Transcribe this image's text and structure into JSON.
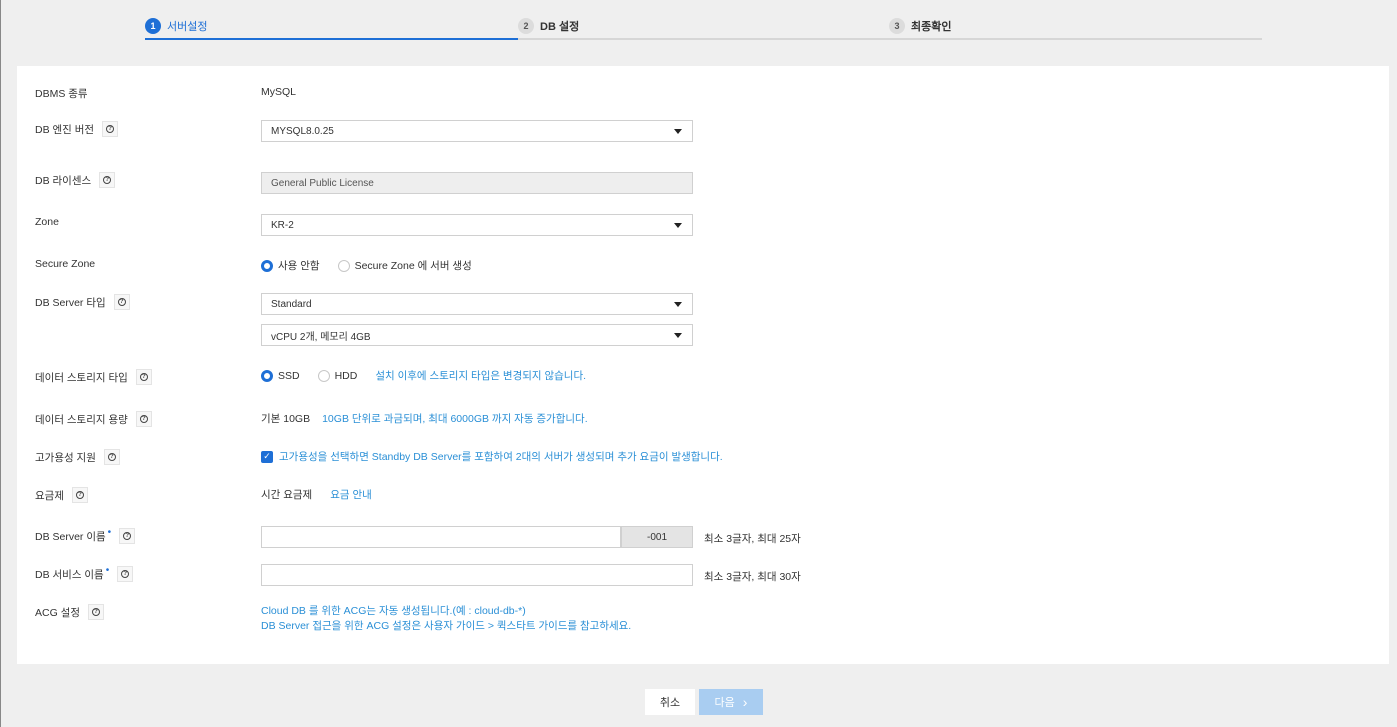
{
  "stepper": {
    "steps": [
      {
        "num": "1",
        "label": "서버설정"
      },
      {
        "num": "2",
        "label": "DB 설정"
      },
      {
        "num": "3",
        "label": "최종확인"
      }
    ]
  },
  "form": {
    "dbms_type": {
      "label": "DBMS 종류",
      "value": "MySQL"
    },
    "engine_version": {
      "label": "DB 엔진 버전",
      "value": "MYSQL8.0.25"
    },
    "license": {
      "label": "DB 라이센스",
      "value": "General Public License"
    },
    "zone": {
      "label": "Zone",
      "value": "KR-2"
    },
    "secure_zone": {
      "label": "Secure Zone",
      "option_off": "사용 안함",
      "option_on": "Secure Zone 에 서버 생성"
    },
    "server_type": {
      "label": "DB Server 타입",
      "type_value": "Standard",
      "spec_value": "vCPU 2개, 메모리 4GB"
    },
    "storage_type": {
      "label": "데이터 스토리지 타입",
      "option_ssd": "SSD",
      "option_hdd": "HDD",
      "note": "설치 이후에 스토리지 타입은 변경되지 않습니다."
    },
    "storage_size": {
      "label": "데이터 스토리지 용량",
      "value": "기본 10GB",
      "note": "10GB 단위로 과금되며, 최대 6000GB 까지 자동 증가합니다."
    },
    "high_availability": {
      "label": "고가용성 지원",
      "note": "고가용성을 선택하면 Standby DB Server를 포함하여 2대의 서버가 생성되며 추가 요금이 발생합니다."
    },
    "billing": {
      "label": "요금제",
      "value": "시간 요금제",
      "link": "요금 안내"
    },
    "server_name": {
      "label": "DB Server 이름",
      "required_mark": "•",
      "suffix": "-001",
      "hint": "최소 3글자, 최대 25자"
    },
    "service_name": {
      "label": "DB 서비스 이름",
      "required_mark": "•",
      "hint": "최소 3글자, 최대 30자"
    },
    "acg": {
      "label": "ACG 설정",
      "line1": "Cloud DB 를 위한 ACG는 자동 생성됩니다.(예 : cloud-db-*)",
      "line2": "DB Server 접근을 위한 ACG 설정은 사용자 가이드 > 퀵스타트 가이드를 참고하세요."
    }
  },
  "footer": {
    "cancel_label": "취소",
    "next_label": "다음",
    "next_arrow": "›"
  },
  "colors": {
    "accent": "#1e6fd6",
    "info_text": "#2a8fd6",
    "next_disabled": "#a9cdf1"
  }
}
